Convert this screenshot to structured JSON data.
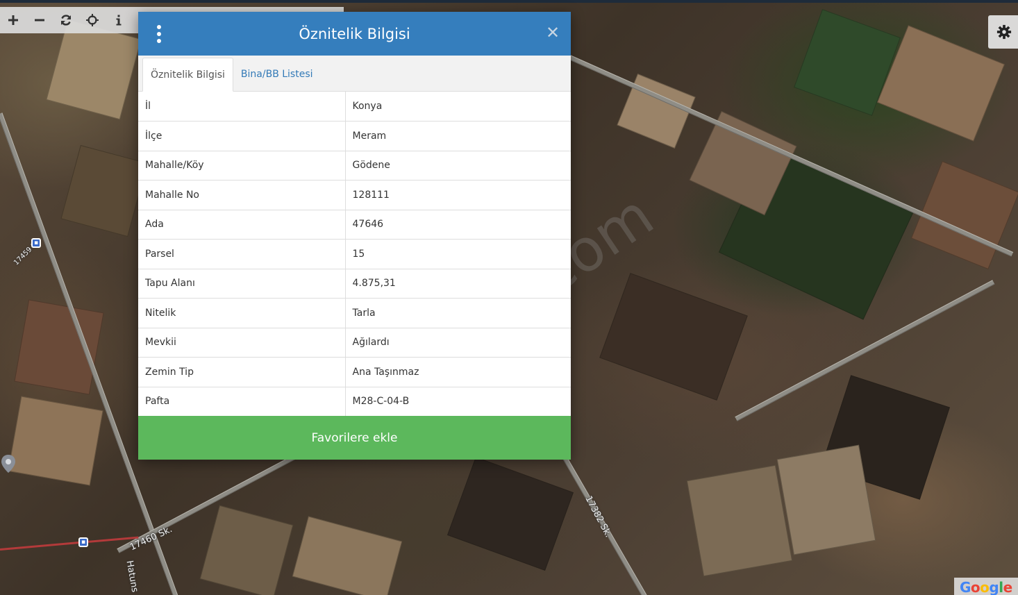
{
  "map": {
    "street_labels": [
      "17459 Sk.",
      "17460 Sk.",
      "17382 Sk.",
      "Hatuns"
    ],
    "attribution": "Google"
  },
  "toolbar": {
    "tools": [
      {
        "name": "zoom-in",
        "glyph": "+"
      },
      {
        "name": "zoom-out",
        "glyph": "−"
      },
      {
        "name": "refresh",
        "glyph": "refresh-icon"
      },
      {
        "name": "locate",
        "glyph": "crosshair-icon"
      },
      {
        "name": "info",
        "glyph": "i"
      }
    ]
  },
  "dialog": {
    "title": "Öznitelik Bilgisi",
    "tabs": [
      {
        "label": "Öznitelik Bilgisi",
        "active": true
      },
      {
        "label": "Bina/BB Listesi",
        "active": false
      }
    ],
    "rows": [
      {
        "key": "İl",
        "value": "Konya"
      },
      {
        "key": "İlçe",
        "value": "Meram"
      },
      {
        "key": "Mahalle/Köy",
        "value": "Gödene"
      },
      {
        "key": "Mahalle No",
        "value": "128111"
      },
      {
        "key": "Ada",
        "value": "47646"
      },
      {
        "key": "Parsel",
        "value": "15"
      },
      {
        "key": "Tapu Alanı",
        "value": "4.875,31"
      },
      {
        "key": "Nitelik",
        "value": "Tarla"
      },
      {
        "key": "Mevkii",
        "value": "Ağılardı"
      },
      {
        "key": "Zemin Tip",
        "value": "Ana Taşınmaz"
      },
      {
        "key": "Pafta",
        "value": "M28-C-04-B"
      }
    ],
    "favorite_button": "Favorilere ekle"
  },
  "watermark": "emlakjet.com",
  "colors": {
    "header": "#357ebd",
    "favorite": "#5cb85c",
    "tab_link": "#337ab7"
  }
}
